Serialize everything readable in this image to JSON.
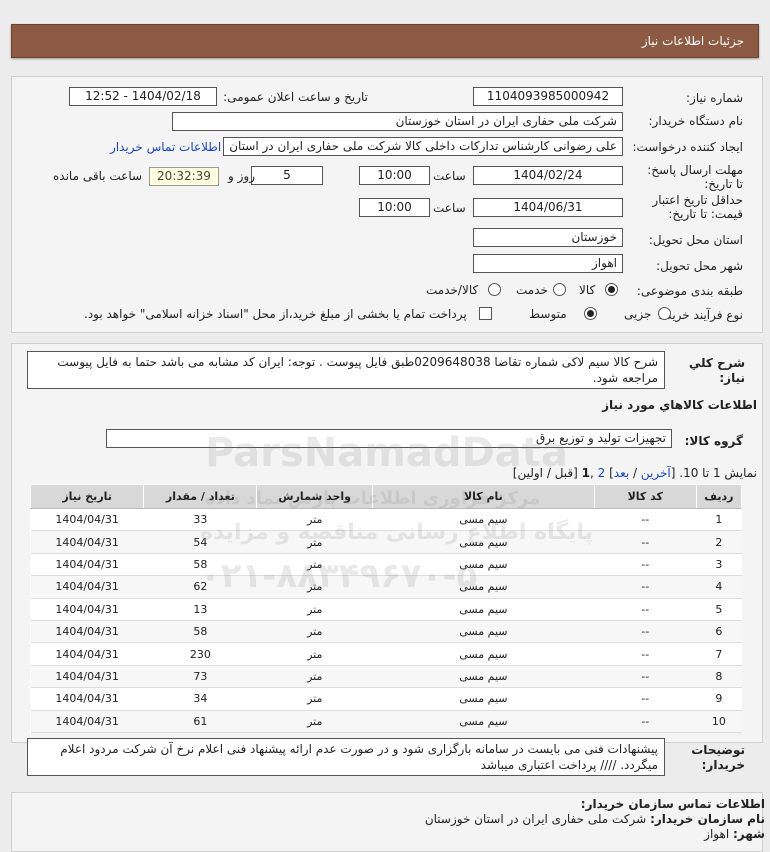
{
  "header": {
    "title": "جزئیات اطلاعات نیاز"
  },
  "form": {
    "need_number_label": "شماره نیاز:",
    "need_number": "1104093985000942",
    "announce_label": "تاریخ و ساعت اعلان عمومی:",
    "announce_value": "1404/02/18 - 12:52",
    "buyer_label": "نام دستگاه خریدار:",
    "buyer_value": "شرکت ملی حفاری ایران در استان خوزستان",
    "creator_label": "ایجاد کننده درخواست:",
    "creator_value": "علی رضوانی کارشناس تدارکات داخلی  کالا شرکت ملی حفاری ایران در استان",
    "contact_link": "اطلاعات تماس خریدار",
    "deadline_label": "مهلت ارسال پاسخ: تا تاریخ:",
    "deadline_date": "1404/02/24",
    "time_label": "ساعت",
    "deadline_time": "10:00",
    "days_value": "5",
    "days_label": "روز و",
    "remaining_value": "20:32:39",
    "remaining_label": "ساعت باقی مانده",
    "validity_label": "حداقل تاریخ اعتبار قیمت: تا تاریخ:",
    "validity_date": "1404/06/31",
    "validity_time": "10:00",
    "province_label": "استان محل تحویل:",
    "province_value": "خوزستان",
    "city_label": "شهر محل تحویل:",
    "city_value": "اهواز",
    "category_label": "طبقه بندی موضوعی:",
    "category_options": [
      "کالا",
      "خدمت",
      "کالا/خدمت"
    ],
    "category_selected": "کالا",
    "purchase_label": "نوع فرآیند خرید :",
    "purchase_options": [
      "جزیی",
      "متوسط"
    ],
    "purchase_selected": "متوسط",
    "treasury_note": "پرداخت تمام یا بخشی از مبلغ خرید،از محل \"اسناد خزانه اسلامی\" خواهد بود."
  },
  "desc": {
    "label": "شرح کلي نياز:",
    "text": "شرح کالا سیم لاکی شماره تقاضا 0209648038طبق فایل پیوست . توجه: ایران کد مشابه می باشد حتما به فایل پیوست مراجعه شود."
  },
  "goods": {
    "section_title": "اطلاعات کالاهاي مورد نياز",
    "group_label": "گروه کالا:",
    "group_value": "تجهیزات تولید و توزیع برق",
    "pager": {
      "prefix": "نمایش 1 تا 10. [",
      "last": "آخرین",
      "slash": " / ",
      "next": "بعد",
      "mid": "] ",
      "page2": "2",
      "sep": " ,",
      "page1": "1",
      "tail": " [قبل / اولین]"
    },
    "columns": [
      "ردیف",
      "کد کالا",
      "نام کالا",
      "واحد شمارش",
      "تعداد / مقدار",
      "تاریخ نیاز"
    ],
    "rows": [
      [
        "1",
        "--",
        "سیم مسی",
        "متر",
        "33",
        "1404/04/31"
      ],
      [
        "2",
        "--",
        "سیم مسی",
        "متر",
        "54",
        "1404/04/31"
      ],
      [
        "3",
        "--",
        "سیم مسی",
        "متر",
        "58",
        "1404/04/31"
      ],
      [
        "4",
        "--",
        "سیم مسی",
        "متر",
        "62",
        "1404/04/31"
      ],
      [
        "5",
        "--",
        "سیم مسی",
        "متر",
        "13",
        "1404/04/31"
      ],
      [
        "6",
        "--",
        "سیم مسی",
        "متر",
        "58",
        "1404/04/31"
      ],
      [
        "7",
        "--",
        "سیم مسی",
        "متر",
        "230",
        "1404/04/31"
      ],
      [
        "8",
        "--",
        "سیم مسی",
        "متر",
        "73",
        "1404/04/31"
      ],
      [
        "9",
        "--",
        "سیم مسی",
        "متر",
        "34",
        "1404/04/31"
      ],
      [
        "10",
        "--",
        "سیم مسی",
        "متر",
        "61",
        "1404/04/31"
      ]
    ]
  },
  "notes": {
    "label": "توضیحات خریدار:",
    "text": "پیشنهادات فنی می بایست در سامانه بارگزاری شود و در صورت عدم ارائه پیشنهاد فنی اعلام نرخ آن شرکت مردود اعلام میگردد. //// پرداخت اعتباری میباشد"
  },
  "contact": {
    "title": "اطلاعات تماس سازمان خریدار:",
    "org_label": "نام سازمان خریدار:",
    "org_value": "شرکت ملی حفاری ایران در استان خوزستان",
    "city_label": "شهر:",
    "city_value": "اهواز"
  },
  "watermark": {
    "line1": "ParsNamadData",
    "line2": "پایگاه اطلاع رسانی مناقصه و مزایده",
    "line3": "مرکز فراوری اطلاعات پارس نماد داده",
    "phone": "۰۲۱-۸۸۳۴۹۶۷۰-۵"
  }
}
